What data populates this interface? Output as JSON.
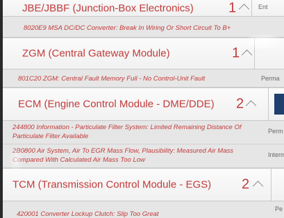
{
  "modules": [
    {
      "name": "JBE/JBBF (Junction-Box Electronics)",
      "count": "1",
      "side": "Ent"
    },
    {
      "name": "ZGM (Central Gateway Module)",
      "count": "1"
    },
    {
      "name": "ECM (Engine Control Module - DME/DDE)",
      "count": "2"
    },
    {
      "name": "TCM (Transmission Control Module - EGS)",
      "count": "2"
    }
  ],
  "faults": [
    {
      "text": "8020E9 MSA DC/DC Converter: Break In Wiring Or Short Circuit To B+"
    },
    {
      "text": "801C20 ZGM: Central Fault Memory Full - No Control-Unit Fault",
      "side": "Perma"
    },
    {
      "line1": "244800 Information - Particulate Filter System: Limited Remaining Distance Of",
      "line2": "Particulate Filter Available",
      "side": "Perm"
    },
    {
      "line1": "2B0800 Air System, Air To EGR Mass Flow, Plausibility: Measured Air Mass",
      "line2": "Compared With Calculated Air Mass Too Low",
      "side": "Interm"
    },
    {
      "text": "420001 Converter Lockup Clutch: Slip Too Great",
      "side": "Pe"
    }
  ]
}
